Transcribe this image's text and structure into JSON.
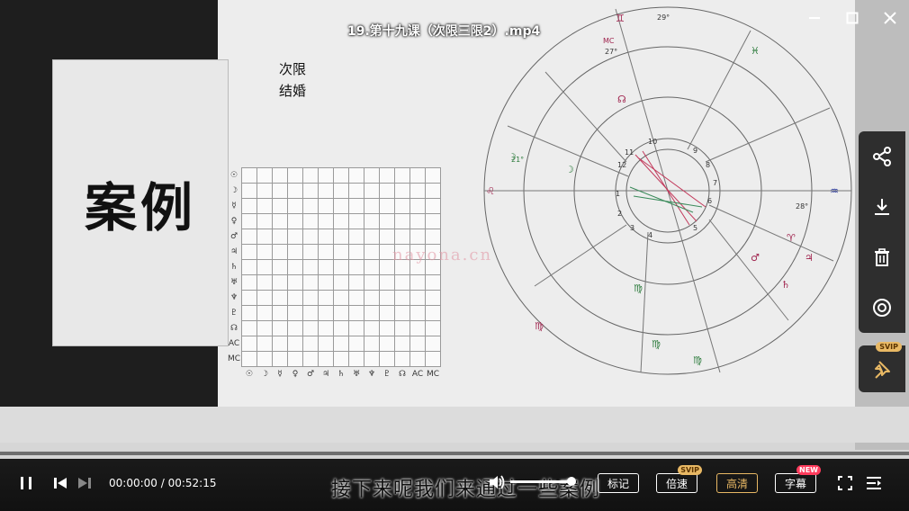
{
  "video": {
    "title": "19.第十九课（次限三限2）.mp4"
  },
  "slide": {
    "case_label": "案例",
    "note_lines": [
      "次限",
      "结婚"
    ],
    "watermark": "nayona.cn"
  },
  "aspect_grid": {
    "row_symbols": [
      "☉",
      "☽",
      "☿",
      "♀",
      "♂",
      "♃",
      "♄",
      "♅",
      "♆",
      "♇",
      "☊",
      "AC",
      "MC"
    ],
    "col_symbols": [
      "☉",
      "☽",
      "☿",
      "♀",
      "♂",
      "♃",
      "♄",
      "♅",
      "♆",
      "♇",
      "☊",
      "AC",
      "MC"
    ]
  },
  "chart_labels": {
    "top": "29°",
    "mc": "MC",
    "mc_deg": "27°",
    "asc_left": "21°",
    "asc_deg": "28°",
    "houses": [
      "10",
      "11",
      "12",
      "1",
      "2",
      "3",
      "4",
      "5",
      "6",
      "7",
      "8",
      "9"
    ]
  },
  "side_panel": {
    "buttons": [
      "share-icon",
      "download-icon",
      "delete-icon",
      "watch-icon"
    ],
    "pin_badge": "SVIP"
  },
  "player": {
    "time_current": "00:00:00",
    "time_total": "00:52:15",
    "time_sep": " / ",
    "subtitle": "接下来呢我们来通过一些案例",
    "progress_fraction": 0.0,
    "volume_fraction": 1.0,
    "mark_label": "标记",
    "speed_label": "倍速",
    "speed_badge": "SVIP",
    "quality_label": "高清",
    "caption_label": "字幕",
    "caption_badge": "NEW"
  }
}
